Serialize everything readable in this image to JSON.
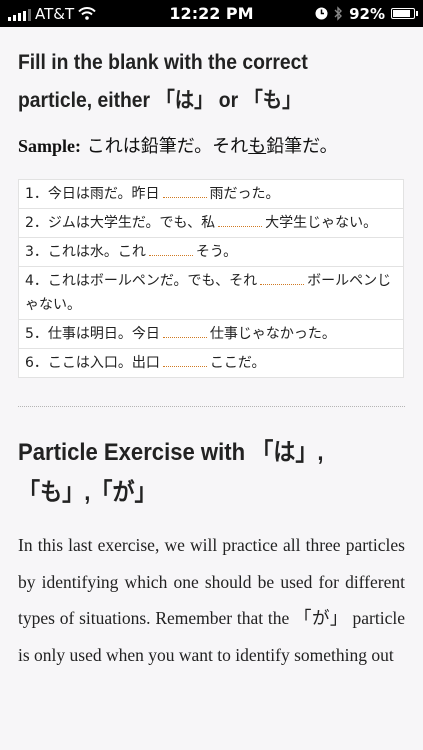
{
  "status": {
    "carrier": "AT&T",
    "time": "12:22 PM",
    "battery": "92%",
    "battery_level": 0.92
  },
  "section1": {
    "title_line1": "Fill in the blank with the correct",
    "title_line2": "particle, either 「は」 or 「も」",
    "sample_label": "Sample:",
    "sample_pre": " これは鉛筆だ。それ",
    "sample_underlined": "も",
    "sample_post": "鉛筆だ。"
  },
  "exercises": [
    {
      "pre": "1．今日は雨だ。昨日",
      "post": "雨だった。"
    },
    {
      "pre": "2．ジムは大学生だ。でも、私",
      "post": "大学生じゃない。"
    },
    {
      "pre": "3．これは水。これ",
      "post": "そう。"
    },
    {
      "pre": "4．これはボールペンだ。でも、それ",
      "post": "ボールペンじゃない。"
    },
    {
      "pre": "5．仕事は明日。今日",
      "post": "仕事じゃなかった。"
    },
    {
      "pre": "6．ここは入口。出口",
      "post": "ここだ。"
    }
  ],
  "section2": {
    "title_line1": "Particle Exercise with 「は」,",
    "title_line2": "「も」,「が」",
    "paragraph": "In this last exercise, we will practice all three particles by identifying which one should be used for different types of situations. Remember that the 「が」 particle is only used when you want to identify something out"
  },
  "colors": {
    "page_bg": "#f7f6f8",
    "blank_underline": "#d07a23",
    "statusbar_bg": "#000000"
  },
  "icons": [
    "signal-bars-icon",
    "wifi-icon",
    "clock-icon",
    "bluetooth-icon",
    "battery-icon"
  ]
}
